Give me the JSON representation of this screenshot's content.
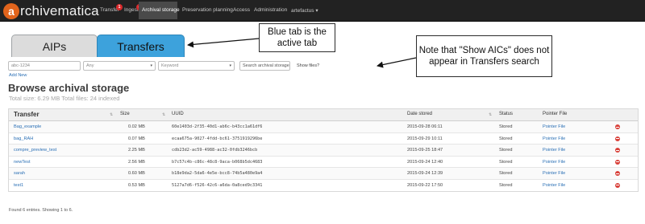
{
  "nav": {
    "logo_mark": "a",
    "logo_text": "rchivematica",
    "items": [
      {
        "label": "Transfer",
        "badge": "1"
      },
      {
        "label": "Ingest",
        "badge": "4"
      },
      {
        "label": "Archival storage"
      },
      {
        "label": "Preservation planning"
      },
      {
        "label": "Access"
      },
      {
        "label": "Administration"
      },
      {
        "label": "artefactus ▾"
      }
    ]
  },
  "tabs": {
    "aips": "AIPs",
    "transfers": "Transfers"
  },
  "callouts": {
    "tab_note": "Blue tab is the active tab",
    "aics_note": "Note that \"Show AICs\" does not appear in Transfers search"
  },
  "search": {
    "query_value": "abc-1234",
    "operator_select": "Any",
    "field_select": "Keyword",
    "scope_select": "Search archival storage",
    "show_files_label": "Show files?"
  },
  "add_new": "Add New",
  "page_title": "Browse archival storage",
  "summary": "Total size: 6.29 MB   Total files: 24 indexed",
  "table": {
    "headers": {
      "transfer": "Transfer",
      "size": "Size",
      "uuid": "UUID",
      "date": "Date stored",
      "status": "Status",
      "pointer": "Pointer File"
    },
    "rows": [
      {
        "name": "Bag_example",
        "size": "0.02 MB",
        "uuid": "60e1403d-2f35-40d1-ab6c-b43cc1a61df6",
        "date": "2015-09-28 06:11",
        "status": "Stored",
        "pointer": "Pointer File"
      },
      {
        "name": "bag_RAH",
        "size": "0.07 MB",
        "uuid": "ecaa675a-9027-4fdd-bc61-3751919296be",
        "date": "2015-09-29 10:11",
        "status": "Stored",
        "pointer": "Pointer File"
      },
      {
        "name": "compre_preview_test",
        "size": "2.25 MB",
        "uuid": "cdb23d2-ac59-4988-ac32-0fdb3246bcb",
        "date": "2015-09-25 18:47",
        "status": "Stored",
        "pointer": "Pointer File"
      },
      {
        "name": "newTest",
        "size": "2.56 MB",
        "uuid": "b7c57c4b-c86c-48c8-9aca-b068b5dc4683",
        "date": "2015-09-24 12:40",
        "status": "Stored",
        "pointer": "Pointer File"
      },
      {
        "name": "sarah",
        "size": "0.60 MB",
        "uuid": "b18e9da2-5da6-4e5e-bcc8-74b5a480e9a4",
        "date": "2015-09-24 12:39",
        "status": "Stored",
        "pointer": "Pointer File"
      },
      {
        "name": "test1",
        "size": "0.53 MB",
        "uuid": "5127a7d6-f526-42c6-a6da-0a8ced9c3341",
        "date": "2015-09-22 17:50",
        "status": "Stored",
        "pointer": "Pointer File"
      }
    ]
  },
  "footer_info": "Found 6 entries. Showing 1 to 6."
}
